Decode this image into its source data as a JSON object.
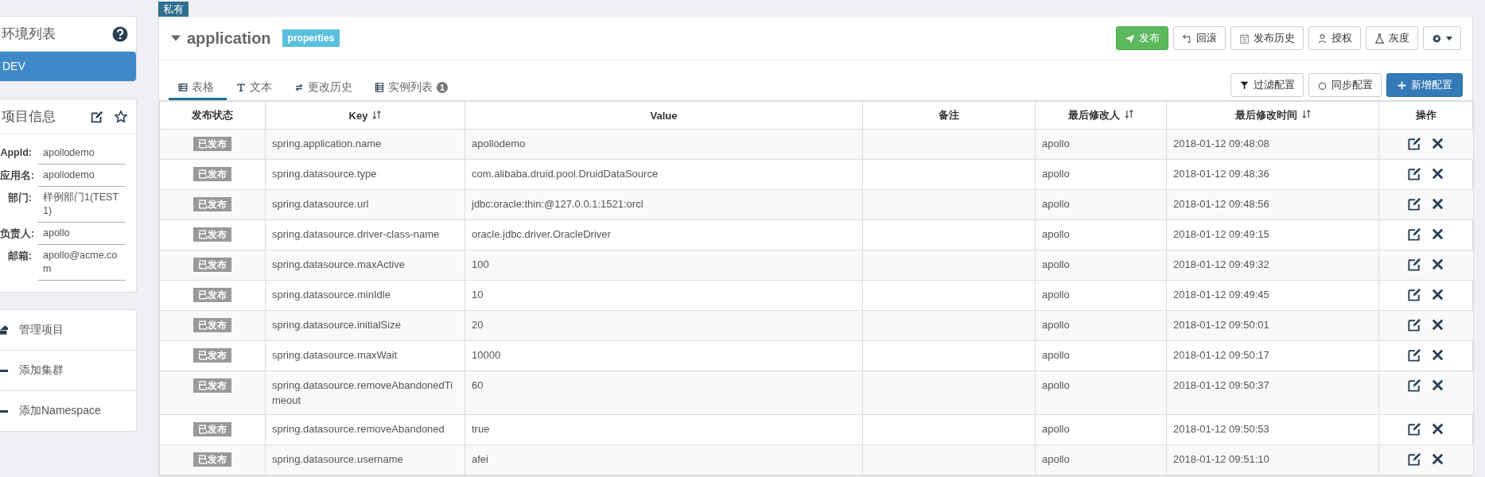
{
  "sidebar": {
    "environments": {
      "title": "环境列表",
      "items": [
        {
          "label": "DEV",
          "selected": true
        }
      ]
    },
    "project_info": {
      "title": "项目信息",
      "fields": [
        {
          "label": "AppId:",
          "value": "apollodemo"
        },
        {
          "label": "应用名:",
          "value": "apollodemo"
        },
        {
          "label": "部门:",
          "value": "样例部门1(TEST1)"
        },
        {
          "label": "负责人:",
          "value": "apollo"
        },
        {
          "label": "邮箱:",
          "value": "apollo@acme.com"
        }
      ]
    },
    "actions": [
      {
        "kind": "manage",
        "label": "管理项目"
      },
      {
        "kind": "add",
        "label": "添加集群"
      },
      {
        "kind": "add",
        "label": "添加Namespace"
      }
    ]
  },
  "namespace": {
    "scope_badge": "私有",
    "name": "application",
    "expanded": true,
    "format_badge": "properties",
    "buttons": [
      {
        "kind": "success",
        "label": "发布"
      },
      {
        "kind": "default",
        "label": "回滚"
      },
      {
        "kind": "default",
        "label": "发布历史"
      },
      {
        "kind": "default",
        "label": "授权"
      },
      {
        "kind": "default",
        "label": "灰度"
      },
      {
        "kind": "settings"
      }
    ],
    "tabs": [
      {
        "label": "表格",
        "selected": true
      },
      {
        "label": "文本",
        "selected": false
      },
      {
        "label": "更改历史",
        "selected": false
      },
      {
        "label": "实例列表",
        "count": "1",
        "selected": false
      }
    ],
    "toolbar": [
      {
        "kind": "default",
        "label": "过滤配置"
      },
      {
        "kind": "default",
        "label": "同步配置"
      },
      {
        "kind": "primary",
        "label": "新增配置"
      }
    ],
    "table": {
      "columns": [
        {
          "label": "发布状态",
          "sortable": false
        },
        {
          "label": "Key",
          "sortable": true
        },
        {
          "label": "Value",
          "sortable": false
        },
        {
          "label": "备注",
          "sortable": false
        },
        {
          "label": "最后修改人",
          "sortable": true
        },
        {
          "label": "最后修改时间",
          "sortable": true
        },
        {
          "label": "操作",
          "sortable": false
        }
      ],
      "rows": [
        {
          "status": "已发布",
          "key": "spring.application.name",
          "value": "apollodemo",
          "modified_by": "apollo",
          "modified_at": "2018-01-12 09:48:08"
        },
        {
          "status": "已发布",
          "key": "spring.datasource.type",
          "value": "com.alibaba.druid.pool.DruidDataSource",
          "modified_by": "apollo",
          "modified_at": "2018-01-12 09:48:36"
        },
        {
          "status": "已发布",
          "key": "spring.datasource.url",
          "value": "jdbc:oracle:thin:@127.0.0.1:1521:orcl",
          "modified_by": "apollo",
          "modified_at": "2018-01-12 09:48:56"
        },
        {
          "status": "已发布",
          "key": "spring.datasource.driver-class-name",
          "value": "oracle.jdbc.driver.OracleDriver",
          "modified_by": "apollo",
          "modified_at": "2018-01-12 09:49:15"
        },
        {
          "status": "已发布",
          "key": "spring.datasource.maxActive",
          "value": "100",
          "modified_by": "apollo",
          "modified_at": "2018-01-12 09:49:32"
        },
        {
          "status": "已发布",
          "key": "spring.datasource.minIdle",
          "value": "10",
          "modified_by": "apollo",
          "modified_at": "2018-01-12 09:49:45"
        },
        {
          "status": "已发布",
          "key": "spring.datasource.initialSize",
          "value": "20",
          "modified_by": "apollo",
          "modified_at": "2018-01-12 09:50:01"
        },
        {
          "status": "已发布",
          "key": "spring.datasource.maxWait",
          "value": "10000",
          "modified_by": "apollo",
          "modified_at": "2018-01-12 09:50:17"
        },
        {
          "status": "已发布",
          "key": "spring.datasource.removeAbandonedTimeout",
          "value": "60",
          "modified_by": "apollo",
          "modified_at": "2018-01-12 09:50:37"
        },
        {
          "status": "已发布",
          "key": "spring.datasource.removeAbandoned",
          "value": "true",
          "modified_by": "apollo",
          "modified_at": "2018-01-12 09:50:53"
        },
        {
          "status": "已发布",
          "key": "spring.datasource.username",
          "value": "afei",
          "modified_by": "apollo",
          "modified_at": "2018-01-12 09:51:10"
        }
      ]
    }
  }
}
